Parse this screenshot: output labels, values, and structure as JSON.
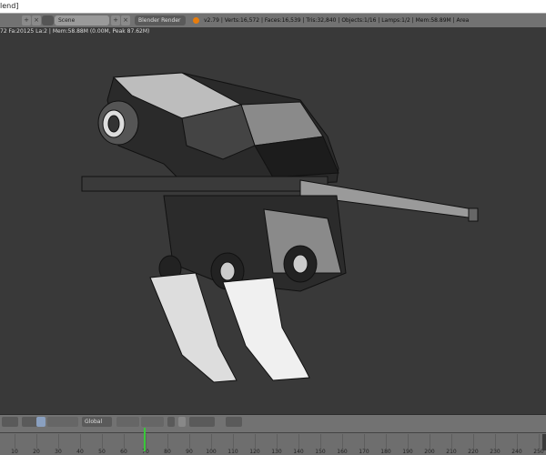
{
  "window": {
    "title_fragment": "lend]"
  },
  "header": {
    "scene_label": "Scene",
    "render_engine": "Blender Render",
    "stats": "v2.79 | Verts:16,572 | Faces:16,539 | Tris:32,840 | Objects:1/16 | Lamps:1/2 | Mem:58.89M | Area"
  },
  "info_line": "72 Fa:20125 La:2 | Mem:58.88M (0.00M, Peak 87.62M)",
  "toolbar": {
    "orientation": "Global"
  },
  "timeline": {
    "ticks": [
      "10",
      "20",
      "30",
      "40",
      "50",
      "60",
      "70",
      "80",
      "90",
      "100",
      "110",
      "120",
      "130",
      "140",
      "150",
      "160",
      "170",
      "180",
      "190",
      "200",
      "210",
      "220",
      "230",
      "240",
      "250"
    ],
    "current_frame": 69,
    "playhead_color": "#3ac83a"
  }
}
